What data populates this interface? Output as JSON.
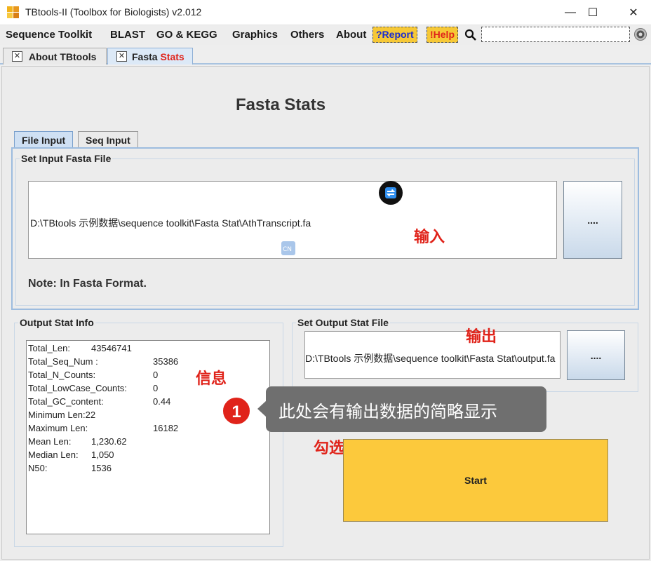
{
  "window": {
    "title": "TBtools-II (Toolbox for Biologists) v2.012",
    "minimize": "—",
    "maximize": "☐",
    "close": "✕"
  },
  "menu": {
    "items": [
      "Sequence Toolkit",
      "BLAST",
      "GO & KEGG",
      "Graphics",
      "Others",
      "About"
    ],
    "report_label": "?Report",
    "help_label": "!Help",
    "search_placeholder": ""
  },
  "doc_tabs": {
    "about": "About TBtools",
    "fasta_prefix": "Fasta ",
    "fasta_suffix": "Stats",
    "close_glyph": "✕"
  },
  "page": {
    "title": "Fasta Stats",
    "tabs": [
      "File Input",
      "Seq Input"
    ],
    "input_group_title": "Set Input Fasta File",
    "input_path": "D:\\TBtools 示例数据\\sequence toolkit\\Fasta Stat\\AthTranscript.fa",
    "browse_label": "....",
    "note": "Note: In Fasta Format.",
    "output_info_title": "Output Stat Info",
    "output_file_title": "Set Output Stat File",
    "output_path": "D:\\TBtools 示例数据\\sequence toolkit\\Fasta Stat\\output.fa",
    "output_browse_label": "....",
    "start_label": "Start"
  },
  "stats": [
    {
      "label": "Total_Len:",
      "value": "43546741"
    },
    {
      "label": "Total_Seq_Num :",
      "value": "35386"
    },
    {
      "label": "Total_N_Counts:",
      "value": "0"
    },
    {
      "label": "Total_LowCase_Counts:",
      "value": "0"
    },
    {
      "label": "Total_GC_content:",
      "value": "0.44"
    },
    {
      "label": "Minimum Len:22",
      "value": ""
    },
    {
      "label": "Maximum Len:",
      "value": "16182"
    },
    {
      "label": "Mean Len:",
      "value": "1,230.62"
    },
    {
      "label": "Median Len:",
      "value": "1,050"
    },
    {
      "label": "N50:",
      "value": "1536"
    }
  ],
  "annotations": {
    "input": "输入",
    "output": "输出",
    "info": "信息",
    "length_only": "勾选后只生成长度",
    "tooltip": "此处会有输出数据的简略显示",
    "step": "1"
  },
  "colors": {
    "accent_yellow": "#fcc93c",
    "annotation_red": "#e0231a",
    "tab_blue": "#cfe0f3"
  }
}
